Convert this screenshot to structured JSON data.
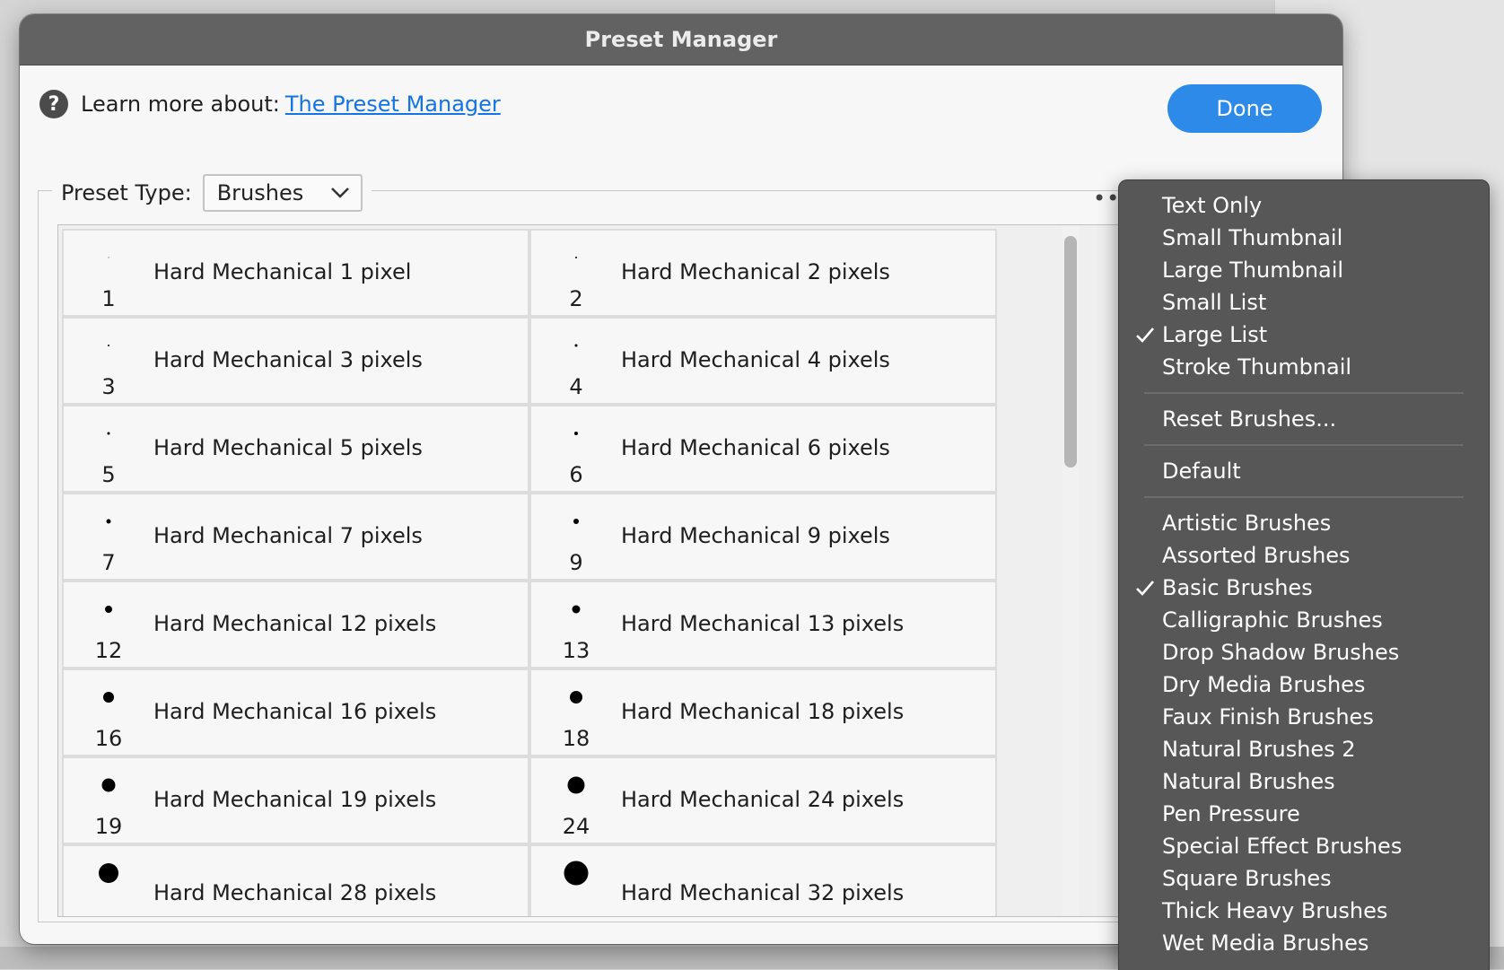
{
  "window": {
    "title": "Preset Manager"
  },
  "help": {
    "label": "Learn more about:",
    "link": "The Preset Manager",
    "icon": "?"
  },
  "done_label": "Done",
  "preset_type": {
    "label": "Preset Type:",
    "value": "Brushes"
  },
  "more_icon": "••",
  "brushes": [
    {
      "size": "1",
      "name": "Hard Mechanical 1 pixel"
    },
    {
      "size": "2",
      "name": "Hard Mechanical 2 pixels"
    },
    {
      "size": "3",
      "name": "Hard Mechanical 3 pixels"
    },
    {
      "size": "4",
      "name": "Hard Mechanical 4 pixels"
    },
    {
      "size": "5",
      "name": "Hard Mechanical 5 pixels"
    },
    {
      "size": "6",
      "name": "Hard Mechanical 6 pixels"
    },
    {
      "size": "7",
      "name": "Hard Mechanical 7 pixels"
    },
    {
      "size": "9",
      "name": "Hard Mechanical 9 pixels"
    },
    {
      "size": "12",
      "name": "Hard Mechanical 12 pixels"
    },
    {
      "size": "13",
      "name": "Hard Mechanical 13 pixels"
    },
    {
      "size": "16",
      "name": "Hard Mechanical 16 pixels"
    },
    {
      "size": "18",
      "name": "Hard Mechanical 18 pixels"
    },
    {
      "size": "19",
      "name": "Hard Mechanical 19 pixels"
    },
    {
      "size": "24",
      "name": "Hard Mechanical 24 pixels"
    },
    {
      "size": "",
      "name": "Hard Mechanical 28 pixels"
    },
    {
      "size": "",
      "name": "Hard Mechanical 32 pixels"
    }
  ],
  "menu": {
    "view_items": [
      {
        "label": "Text Only",
        "checked": false
      },
      {
        "label": "Small Thumbnail",
        "checked": false
      },
      {
        "label": "Large Thumbnail",
        "checked": false
      },
      {
        "label": "Small List",
        "checked": false
      },
      {
        "label": "Large List",
        "checked": true
      },
      {
        "label": "Stroke Thumbnail",
        "checked": false
      }
    ],
    "reset_label": "Reset Brushes...",
    "default_label": "Default",
    "library_items": [
      {
        "label": "Artistic Brushes",
        "checked": false
      },
      {
        "label": "Assorted Brushes",
        "checked": false
      },
      {
        "label": "Basic Brushes",
        "checked": true
      },
      {
        "label": "Calligraphic Brushes",
        "checked": false
      },
      {
        "label": "Drop Shadow Brushes",
        "checked": false
      },
      {
        "label": "Dry Media Brushes",
        "checked": false
      },
      {
        "label": "Faux Finish Brushes",
        "checked": false
      },
      {
        "label": "Natural Brushes 2",
        "checked": false
      },
      {
        "label": "Natural Brushes",
        "checked": false
      },
      {
        "label": "Pen Pressure",
        "checked": false
      },
      {
        "label": "Special Effect Brushes",
        "checked": false
      },
      {
        "label": "Square Brushes",
        "checked": false
      },
      {
        "label": "Thick Heavy Brushes",
        "checked": false
      },
      {
        "label": "Wet Media Brushes",
        "checked": false
      }
    ]
  },
  "colors": {
    "accent": "#2d8ae9",
    "link": "#1473e6",
    "menu_bg": "#575757",
    "titlebar": "#626262"
  }
}
